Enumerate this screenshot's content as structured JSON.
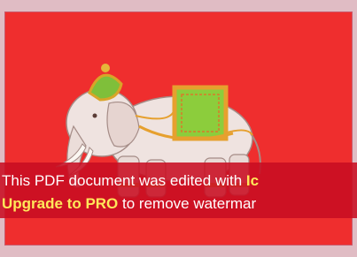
{
  "watermark": {
    "line1_text": "This PDF document was edited with ",
    "line1_bold": "Ic",
    "line2_bold": "Upgrade to PRO",
    "line2_text": " to remove watermar"
  },
  "colors": {
    "flag_red": "#ef2e2e",
    "banner_red": "#c80e22",
    "page_pink": "#e0bcc4",
    "highlight_yellow": "#ffe85a"
  },
  "icons": [
    "white-elephant-emblem"
  ]
}
